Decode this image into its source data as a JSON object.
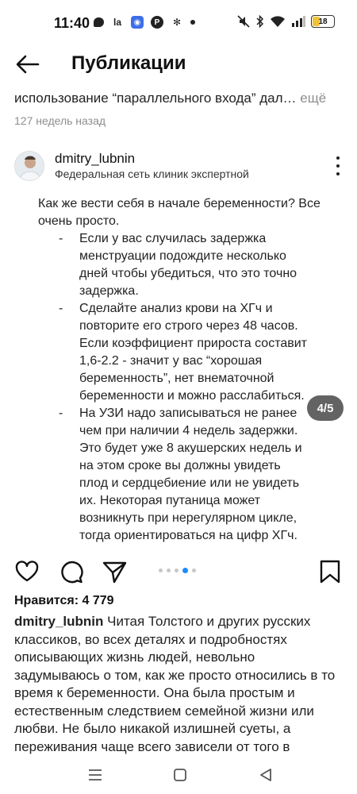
{
  "status_bar": {
    "time": "11:40",
    "battery": "18",
    "left_icons": [
      "chat-icon",
      "vk-icon",
      "podcast-icon",
      "pinterest-icon",
      "snowflake-icon",
      "dot-icon"
    ],
    "right_icons": [
      "mute-icon",
      "bluetooth-icon",
      "wifi-icon",
      "signal-icon",
      "battery-icon"
    ]
  },
  "header": {
    "title": "Публикации"
  },
  "previous_post": {
    "caption": "использование “параллельного входа” дал…",
    "more_label": " ещё",
    "date": "127 недель назад"
  },
  "post": {
    "username": "dmitry_lubnin",
    "subtitle": "Федеральная сеть клиник экспертной",
    "slide_counter": "4/5",
    "slide_count": 5,
    "active_slide": 4,
    "image_intro": "Как же вести себя в начале беременности? Все очень просто.",
    "image_bullets": [
      "Если у вас случилась задержка менструации подождите несколько дней чтобы убедиться, что это точно задержка.",
      "Сделайте анализ крови на ХГч и повторите его строго через 48 часов. Если коэффициент прироста составит 1,6-2.2 - значит у вас “хорошая беременность”, нет внематочной беременности и можно расслабиться.",
      "На УЗИ надо записываться не ранее чем при наличии 4 недель задержки. Это будет уже 8 акушерских недель и на этом сроке вы должны увидеть плод и сердцебиение или не увидеть их. Некоторая путаница может возникнуть при нерегулярном цикле, тогда ориентироваться на цифр ХГч."
    ],
    "bullet_dash": "-",
    "likes": "Нравится: 4 779",
    "caption_user": "dmitry_lubnin",
    "caption_text": " Читая Толстого и других русских классиков, во всех деталях и подробностях описывающих жизнь людей, невольно задумываюсь о том, как же просто относились в то время к беременности. Она была простым и естественным следствием семейной жизни или любви. Не было никакой излишней суеты, а переживания чаще всего зависели от того в"
  },
  "colors": {
    "accent_dot": "#1a8cff",
    "muted_text": "#8e8e8e",
    "battery_fill": "#f0c23a"
  }
}
